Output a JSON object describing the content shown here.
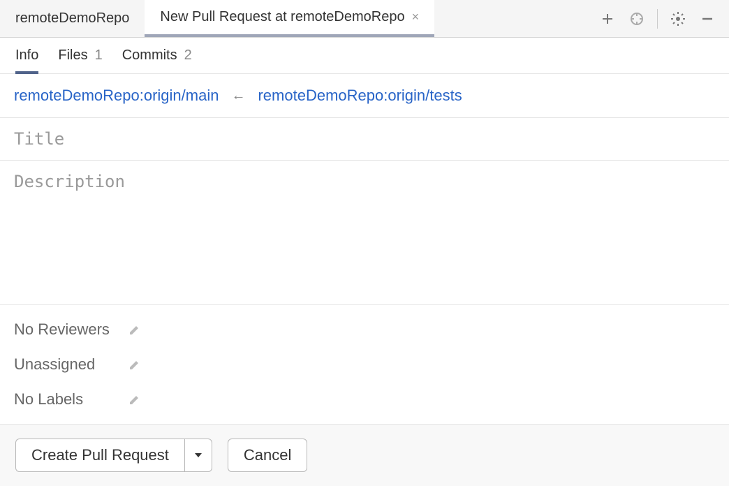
{
  "tabs": {
    "inactive": "remoteDemoRepo",
    "active": "New Pull Request at remoteDemoRepo"
  },
  "sub_tabs": {
    "info": "Info",
    "files": {
      "label": "Files",
      "count": "1"
    },
    "commits": {
      "label": "Commits",
      "count": "2"
    }
  },
  "branches": {
    "target": "remoteDemoRepo:origin/main",
    "source": "remoteDemoRepo:origin/tests"
  },
  "fields": {
    "title_placeholder": "Title",
    "description_placeholder": "Description"
  },
  "meta": {
    "reviewers": "No Reviewers",
    "assignee": "Unassigned",
    "labels": "No Labels"
  },
  "footer": {
    "create": "Create Pull Request",
    "cancel": "Cancel"
  }
}
